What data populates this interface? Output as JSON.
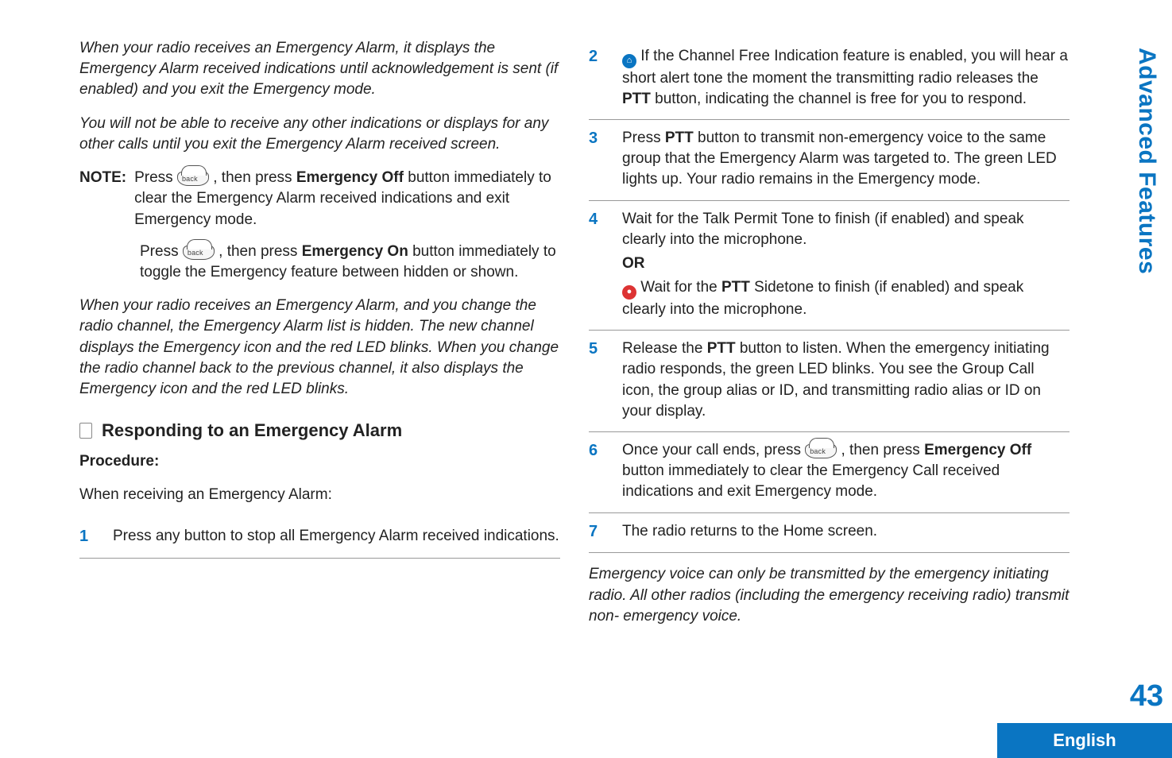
{
  "left": {
    "para1": "When your radio receives an Emergency Alarm, it displays the Emergency Alarm received indications until acknowledgement is sent (if enabled) and you exit the Emergency mode.",
    "para2": "You will not be able to receive any other indications or displays for any other calls until you exit the Emergency Alarm received screen.",
    "note_label": "NOTE:",
    "note1_pre": "Press ",
    "note1_mid": ", then press ",
    "note1_bold1": "Emergency Off",
    "note1_tail": " button immediately to clear the Emergency Alarm received indications and exit Emergency mode.",
    "note2_pre": "Press ",
    "note2_mid": ", then press ",
    "note2_bold1": "Emergency On",
    "note2_tail": " button immediately to toggle the Emergency feature between hidden or shown.",
    "para3": "When your radio receives an Emergency Alarm, and you change the radio channel, the Emergency Alarm list is hidden. The new channel displays the Emergency icon and the red LED blinks. When you change the radio channel back to the previous channel, it also displays the Emergency icon and the red LED blinks.",
    "section_title": "Responding to an Emergency Alarm",
    "procedure_label": "Procedure:",
    "intro": "When receiving an Emergency Alarm:",
    "step1": "Press any button to stop all Emergency Alarm received indications."
  },
  "right": {
    "step2_pre": " If the Channel Free Indication feature is enabled, you will hear a short alert tone the moment the transmitting radio releases the ",
    "step2_bold1": "PTT",
    "step2_tail": " button, indicating the channel is free for you to respond.",
    "step3_pre": "Press ",
    "step3_bold1": "PTT",
    "step3_tail": " button to transmit non-emergency voice to the same group that the Emergency Alarm was targeted to. The green LED lights up. Your radio remains in the Emergency mode.",
    "step4a": "Wait for the Talk Permit Tone to finish (if enabled) and speak clearly into the microphone.",
    "step4_or": "OR",
    "step4b_pre": " Wait for the ",
    "step4b_bold": "PTT",
    "step4b_tail": " Sidetone to finish (if enabled) and speak clearly into the microphone.",
    "step5_pre": "Release the ",
    "step5_bold": "PTT",
    "step5_tail": " button to listen. When the emergency initiating radio responds, the green LED blinks. You see the Group Call icon, the group alias or ID, and transmitting radio alias or ID on your display.",
    "step6_pre": "Once your call ends, press ",
    "step6_mid": ", then press ",
    "step6_bold": "Emergency Off",
    "step6_tail": " button immediately to clear the Emergency Call received indications and exit Emergency mode.",
    "step7": "The radio returns to the Home screen.",
    "closing": "Emergency voice can only be transmitted by the emergency initiating radio. All other radios (including the emergency receiving radio) transmit non- emergency voice."
  },
  "chrome": {
    "section_label": "Advanced Features",
    "page_number": "43",
    "language": "English"
  },
  "steps": {
    "n1": "1",
    "n2": "2",
    "n3": "3",
    "n4": "4",
    "n5": "5",
    "n6": "6",
    "n7": "7"
  }
}
